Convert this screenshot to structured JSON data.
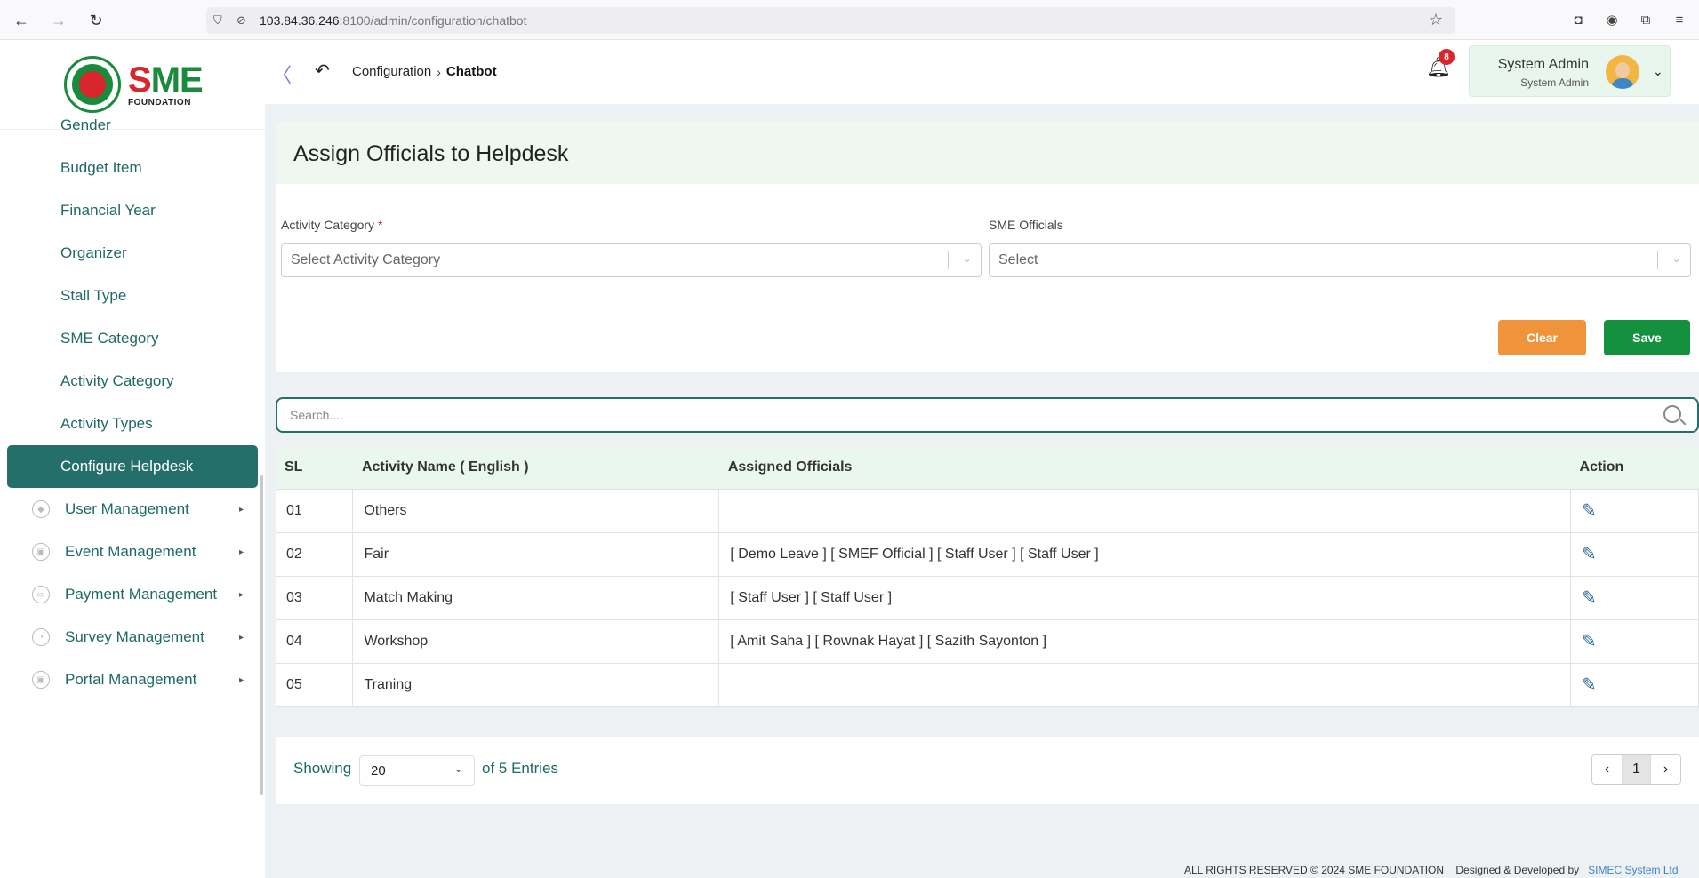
{
  "browser": {
    "url_host": "103.84.36.246",
    "url_path": ":8100/admin/configuration/chatbot"
  },
  "brand": {
    "logo_letters": "SME",
    "logo_sub": "FOUNDATION"
  },
  "sidebar": {
    "items": [
      {
        "label": "Gender"
      },
      {
        "label": "Budget Item"
      },
      {
        "label": "Financial Year"
      },
      {
        "label": "Organizer"
      },
      {
        "label": "Stall Type"
      },
      {
        "label": "SME Category"
      },
      {
        "label": "Activity Category"
      },
      {
        "label": "Activity Types"
      },
      {
        "label": "Configure Helpdesk",
        "active": true
      }
    ],
    "groups": [
      {
        "label": "User Management",
        "icon": "shield-icon"
      },
      {
        "label": "Event Management",
        "icon": "lock-icon"
      },
      {
        "label": "Payment Management",
        "icon": "payment-icon"
      },
      {
        "label": "Survey Management",
        "icon": "pie-chart-icon"
      },
      {
        "label": "Portal Management",
        "icon": "lock-icon"
      }
    ]
  },
  "header": {
    "breadcrumb_parent": "Configuration",
    "breadcrumb_current": "Chatbot",
    "notification_count": "8",
    "user_name": "System Admin",
    "user_role": "System Admin"
  },
  "form": {
    "title": "Assign Officials to Helpdesk",
    "category_label": "Activity Category",
    "category_required": "*",
    "category_placeholder": "Select Activity Category",
    "officials_label": "SME Officials",
    "officials_placeholder": "Select",
    "clear_label": "Clear",
    "save_label": "Save"
  },
  "search": {
    "placeholder": "Search...."
  },
  "table": {
    "headers": [
      "SL",
      "Activity Name ( English )",
      "Assigned Officials",
      "Action"
    ],
    "rows": [
      {
        "sl": "01",
        "name": "Others",
        "officials": ""
      },
      {
        "sl": "02",
        "name": "Fair",
        "officials": "[ Demo Leave ]  [ SMEF Official ]  [ Staff User ]  [ Staff User ]"
      },
      {
        "sl": "03",
        "name": "Match Making",
        "officials": "[ Staff User ]  [ Staff User ]"
      },
      {
        "sl": "04",
        "name": "Workshop",
        "officials": "[ Amit Saha ]  [ Rownak Hayat ]  [ Sazith Sayonton ]"
      },
      {
        "sl": "05",
        "name": "Traning",
        "officials": ""
      }
    ]
  },
  "pagination": {
    "showing_label": "Showing",
    "page_size": "20",
    "entries_label": "of 5 Entries",
    "current_page": "1"
  },
  "footer": {
    "copyright": "ALL RIGHTS RESERVED © 2024 SME FOUNDATION",
    "designed_label": "Designed & Developed by",
    "developer": "SIMEC System Ltd"
  },
  "colors": {
    "primary": "#246f6a",
    "save": "#13913e",
    "clear": "#f0943c",
    "badge": "#d9252c"
  }
}
